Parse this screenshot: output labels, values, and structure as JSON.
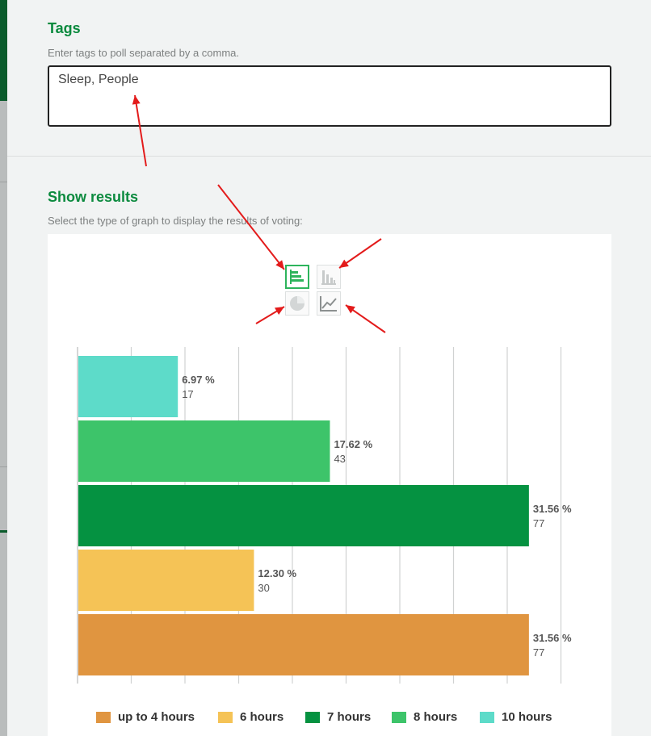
{
  "tags": {
    "title": "Tags",
    "hint": "Enter tags to poll separated by a comma.",
    "value": "Sleep, People"
  },
  "results": {
    "title": "Show results",
    "hint": "Select the type of graph to display the results of voting:",
    "graph_types": [
      {
        "icon": "horizontal-bar-chart-icon",
        "selected": true
      },
      {
        "icon": "vertical-bar-chart-icon",
        "selected": false
      },
      {
        "icon": "pie-chart-icon",
        "selected": false
      },
      {
        "icon": "line-chart-icon",
        "selected": false
      }
    ]
  },
  "chart_data": {
    "type": "bar",
    "orientation": "horizontal",
    "xlim": [
      0,
      34
    ],
    "grid": true,
    "legend_placement": "bottom",
    "categories": [
      "10 hours",
      "8 hours",
      "7 hours",
      "6 hours",
      "up to 4 hours"
    ],
    "percent_labels": [
      "6.97 %",
      "17.62 %",
      "31.56 %",
      "12.30 %",
      "31.56 %"
    ],
    "values": [
      6.97,
      17.62,
      31.56,
      12.3,
      31.56
    ],
    "counts": [
      "17",
      "43",
      "77",
      "30",
      "77"
    ],
    "colors": [
      "#5ddbc9",
      "#3dc46a",
      "#059241",
      "#f5c356",
      "#e09540"
    ],
    "legend": [
      {
        "label": "up to 4 hours",
        "color": "#e09540"
      },
      {
        "label": "6 hours",
        "color": "#f5c356"
      },
      {
        "label": "7 hours",
        "color": "#059241"
      },
      {
        "label": "8 hours",
        "color": "#3dc46a"
      },
      {
        "label": "10 hours",
        "color": "#5ddbc9"
      }
    ]
  },
  "annotations": {
    "arrow_color": "#e31b1b"
  }
}
